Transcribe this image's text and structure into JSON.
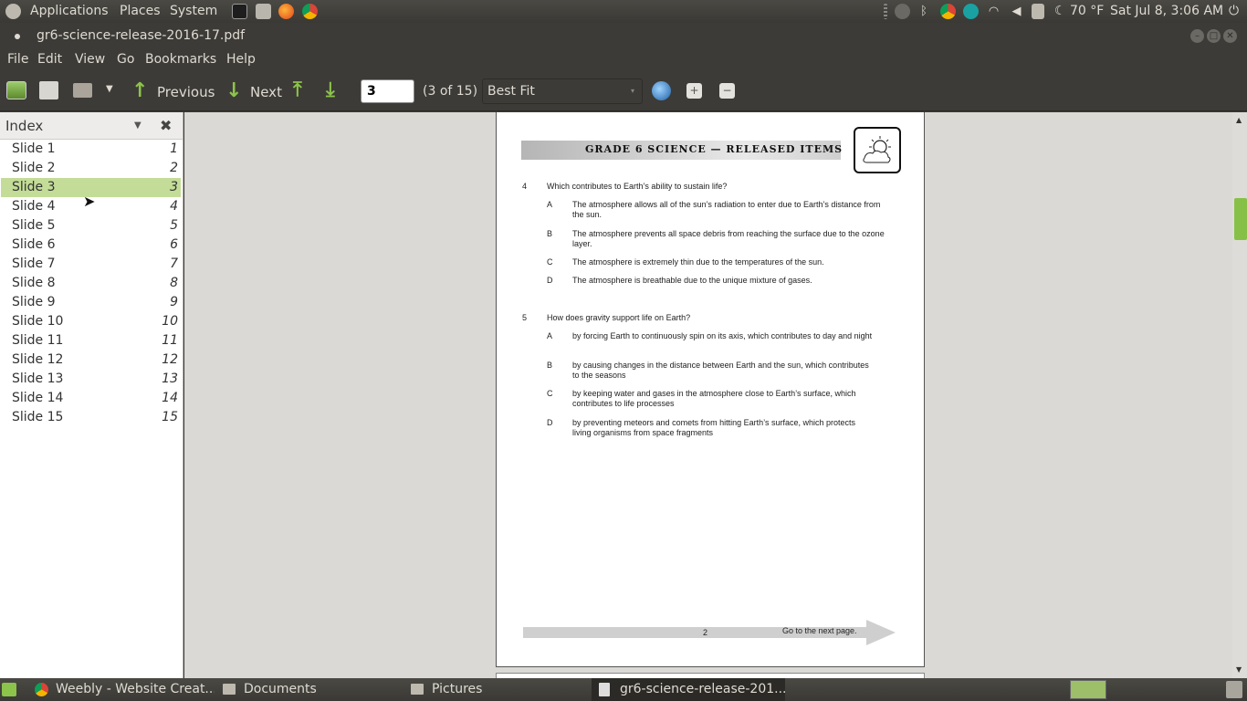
{
  "top_panel": {
    "applications": "Applications",
    "places": "Places",
    "system": "System",
    "weather": "70 °F",
    "clock": "Sat Jul 8,  3:06 AM"
  },
  "window": {
    "title": "gr6-science-release-2016-17.pdf"
  },
  "menubar": {
    "file": "File",
    "edit": "Edit",
    "view": "View",
    "go": "Go",
    "bookmarks": "Bookmarks",
    "help": "Help"
  },
  "toolbar": {
    "previous": "Previous",
    "next": "Next",
    "page_value": "3",
    "page_of": "(3 of 15)",
    "zoom": "Best Fit"
  },
  "sidebar": {
    "title": "Index",
    "items": [
      {
        "label": "Slide 1",
        "num": "1"
      },
      {
        "label": "Slide 2",
        "num": "2"
      },
      {
        "label": "Slide 3",
        "num": "3"
      },
      {
        "label": "Slide 4",
        "num": "4"
      },
      {
        "label": "Slide 5",
        "num": "5"
      },
      {
        "label": "Slide 6",
        "num": "6"
      },
      {
        "label": "Slide 7",
        "num": "7"
      },
      {
        "label": "Slide 8",
        "num": "8"
      },
      {
        "label": "Slide 9",
        "num": "9"
      },
      {
        "label": "Slide 10",
        "num": "10"
      },
      {
        "label": "Slide 11",
        "num": "11"
      },
      {
        "label": "Slide 12",
        "num": "12"
      },
      {
        "label": "Slide 13",
        "num": "13"
      },
      {
        "label": "Slide 14",
        "num": "14"
      },
      {
        "label": "Slide 15",
        "num": "15"
      }
    ],
    "selected_index": 2
  },
  "document": {
    "header": "GRADE 6 SCIENCE — RELEASED ITEMS",
    "q4": {
      "num": "4",
      "text": "Which contributes to Earth’s ability to sustain life?",
      "a": "The atmosphere allows all of the sun’s radiation to enter due to Earth’s distance from the sun.",
      "b": "The atmosphere prevents all space debris from reaching the surface due to the ozone layer.",
      "c": "The atmosphere is extremely thin due to the temperatures of the sun.",
      "d": "The atmosphere is breathable due to the unique mixture of gases."
    },
    "q5": {
      "num": "5",
      "text": "How does gravity support life on Earth?",
      "a": "by forcing Earth to continuously spin on its axis, which contributes to day and night",
      "b": "by causing changes in the distance between Earth and the sun, which contributes to the seasons",
      "c": "by keeping water and gases in the atmosphere close to Earth’s surface, which contributes to life processes",
      "d": "by preventing meteors and comets from hitting Earth’s surface, which protects living organisms from space fragments"
    },
    "letters": {
      "a": "A",
      "b": "B",
      "c": "C",
      "d": "D"
    },
    "page_number": "2",
    "next_page": "Go to the next page."
  },
  "taskbar": {
    "items": [
      {
        "label": "Weebly - Website Creat..."
      },
      {
        "label": "Documents"
      },
      {
        "label": "Pictures"
      },
      {
        "label": "gr6-science-release-201..."
      }
    ]
  },
  "colors": {
    "selection": "#c3dc97",
    "scroll_thumb": "#87c046",
    "panel": "#3c3b37"
  }
}
